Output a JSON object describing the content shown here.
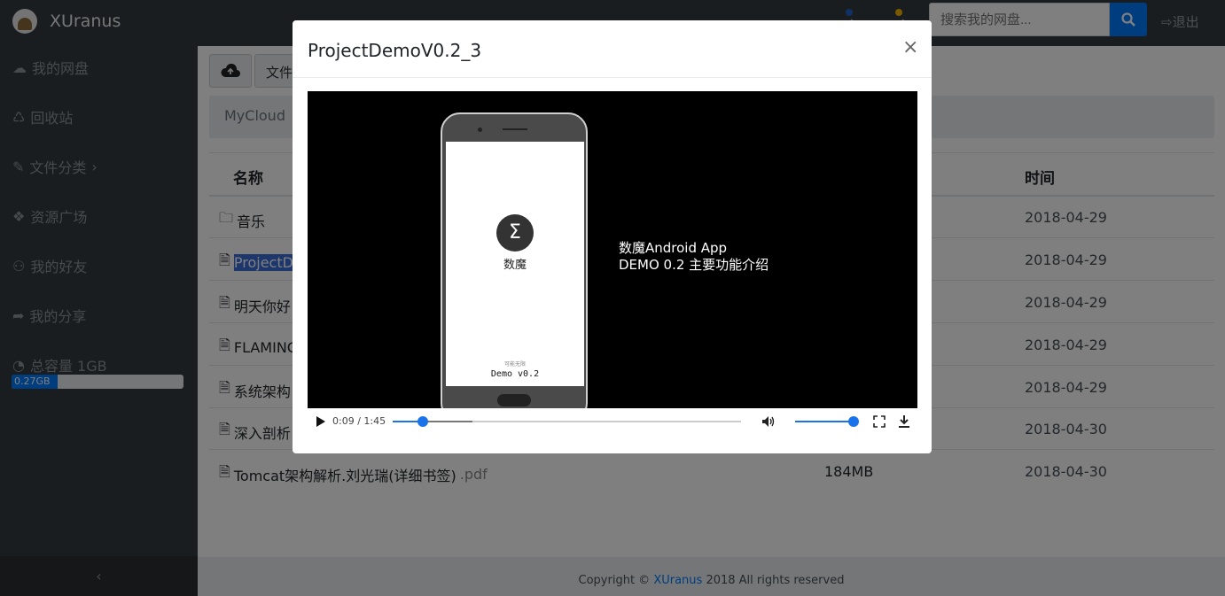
{
  "app": {
    "name": "XUranus"
  },
  "header": {
    "search_placeholder": "搜索我的网盘...",
    "logout_label": "退出"
  },
  "sidebar": {
    "items": [
      {
        "label": "我的网盘",
        "icon": "cloud-icon"
      },
      {
        "label": "回收站",
        "icon": "recycle-icon"
      },
      {
        "label": "文件分类",
        "icon": "wrench-icon",
        "suffix": "›"
      },
      {
        "label": "资源广场",
        "icon": "cubes-icon"
      },
      {
        "label": "我的好友",
        "icon": "users-icon"
      },
      {
        "label": "我的分享",
        "icon": "share-icon"
      }
    ],
    "quota": {
      "label": "总容量 1GB",
      "used": "0.27GB",
      "used_fraction": 0.27
    },
    "collapse_label": "‹"
  },
  "toolbar": {
    "file_button_partial": "文件"
  },
  "breadcrumb": {
    "root": "MyCloud"
  },
  "table": {
    "headers": {
      "name": "名称",
      "time": "时间"
    },
    "rows": [
      {
        "name": "音乐",
        "type": "folder",
        "time": "2018-04-29"
      },
      {
        "name": "ProjectDe",
        "type": "file",
        "time": "2018-04-29",
        "selected": true
      },
      {
        "name": "明天你好",
        "type": "file",
        "time": "2018-04-29"
      },
      {
        "name": "FLAMINC",
        "type": "file",
        "time": "2018-04-29"
      },
      {
        "name": "系统架构",
        "type": "file",
        "time": "2018-04-29"
      },
      {
        "name": "深入剖析",
        "type": "file",
        "time": "2018-04-30"
      },
      {
        "name": "Tomcat架构解析.刘光瑞(详细书签)",
        "ext": ".pdf",
        "type": "file",
        "size": "184MB",
        "time": "2018-04-30"
      }
    ]
  },
  "footer": {
    "prefix": "Copyright ©",
    "link": "XUranus",
    "suffix": "2018 All rights reserved"
  },
  "modal": {
    "title": "ProjectDemoV0.2_3",
    "close_label": "×",
    "video": {
      "app_name": "数魔",
      "small_caption": "可能无限",
      "version": "Demo v0.2",
      "title_line1": "数魔Android App",
      "title_line2": "DEMO 0.2 主要功能介绍",
      "time_display": "0:09 / 1:45",
      "played_fraction": 0.086,
      "buffered_fraction": 0.23,
      "volume_fraction": 1.0
    }
  },
  "colors": {
    "accent": "#007bff",
    "sidebar_bg": "#343a40",
    "player_accent": "#1a73e8"
  }
}
